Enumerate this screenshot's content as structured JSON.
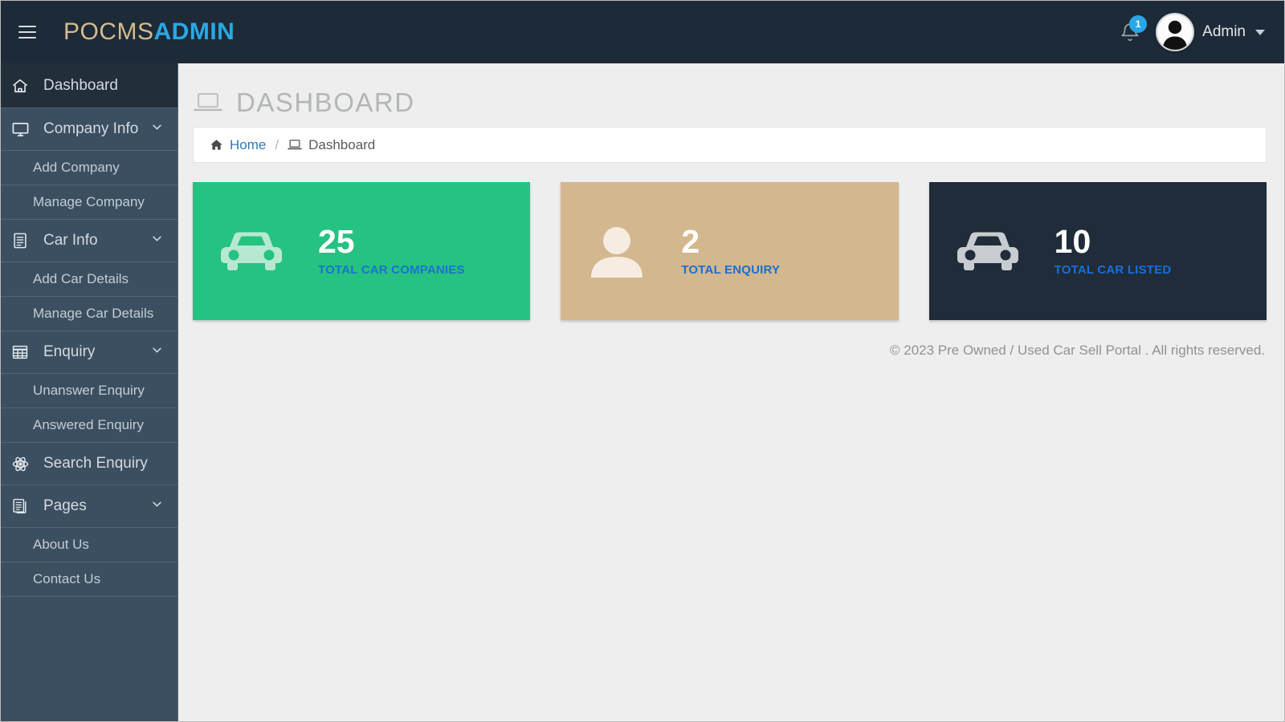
{
  "header": {
    "menu_icon": "hamburger-icon",
    "brand_primary": "POCMS",
    "brand_secondary": "ADMIN",
    "notification_icon": "bell-icon",
    "notification_count": "1",
    "avatar_icon": "user-avatar-icon",
    "user_name": "Admin",
    "caret_icon": "caret-down-icon",
    "colors": {
      "bar_background": "#1d2a37",
      "brand_primary": "#d6bb8e",
      "brand_secondary": "#2ba7e4",
      "badge": "#29a7e8"
    }
  },
  "sidebar": {
    "background": "#3c4f60",
    "active_background": "#232e3b",
    "items": [
      {
        "label": "Dashboard",
        "icon": "home-icon",
        "type": "item",
        "active": true,
        "expandable": false
      },
      {
        "label": "Company Info",
        "icon": "monitor-icon",
        "type": "item",
        "active": false,
        "expandable": true
      },
      {
        "label": "Add Company",
        "icon": "",
        "type": "subitem",
        "active": false,
        "expandable": false
      },
      {
        "label": "Manage Company",
        "icon": "",
        "type": "subitem",
        "active": false,
        "expandable": false
      },
      {
        "label": "Car Info",
        "icon": "file-text-icon",
        "type": "item",
        "active": false,
        "expandable": true
      },
      {
        "label": "Add Car Details",
        "icon": "",
        "type": "subitem",
        "active": false,
        "expandable": false
      },
      {
        "label": "Manage Car Details",
        "icon": "",
        "type": "subitem",
        "active": false,
        "expandable": false
      },
      {
        "label": "Enquiry",
        "icon": "table-icon",
        "type": "item",
        "active": false,
        "expandable": true
      },
      {
        "label": "Unanswer Enquiry",
        "icon": "",
        "type": "subitem",
        "active": false,
        "expandable": false
      },
      {
        "label": "Answered Enquiry",
        "icon": "",
        "type": "subitem",
        "active": false,
        "expandable": false
      },
      {
        "label": "Search Enquiry",
        "icon": "atom-icon",
        "type": "item",
        "active": false,
        "expandable": false
      },
      {
        "label": "Pages",
        "icon": "pages-icon",
        "type": "item",
        "active": false,
        "expandable": true
      },
      {
        "label": "About Us",
        "icon": "",
        "type": "subitem",
        "active": false,
        "expandable": false
      },
      {
        "label": "Contact Us",
        "icon": "",
        "type": "subitem",
        "active": false,
        "expandable": false
      }
    ]
  },
  "page": {
    "title": "DASHBOARD",
    "title_icon": "laptop-icon"
  },
  "breadcrumb": {
    "home_icon": "home-icon",
    "home_label": "Home",
    "separator": "/",
    "current_icon": "laptop-icon",
    "current_label": "Dashboard"
  },
  "stats": [
    {
      "value": "25",
      "label": "TOTAL CAR COMPANIES",
      "icon": "car-icon",
      "background": "#25c281",
      "icon_color": "#b7e9d2",
      "label_color": "#1a73cf"
    },
    {
      "value": "2",
      "label": "TOTAL ENQUIRY",
      "icon": "user-icon",
      "background": "#d3b78f",
      "icon_color": "#f7ece1",
      "label_color": "#1a6ed0"
    },
    {
      "value": "10",
      "label": "TOTAL CAR LISTED",
      "icon": "car-icon",
      "background": "#212c3a",
      "icon_color": "#c8ccd0",
      "label_color": "#176fdb"
    }
  ],
  "footer": {
    "text": "© 2023 Pre Owned / Used Car Sell Portal . All rights reserved."
  }
}
